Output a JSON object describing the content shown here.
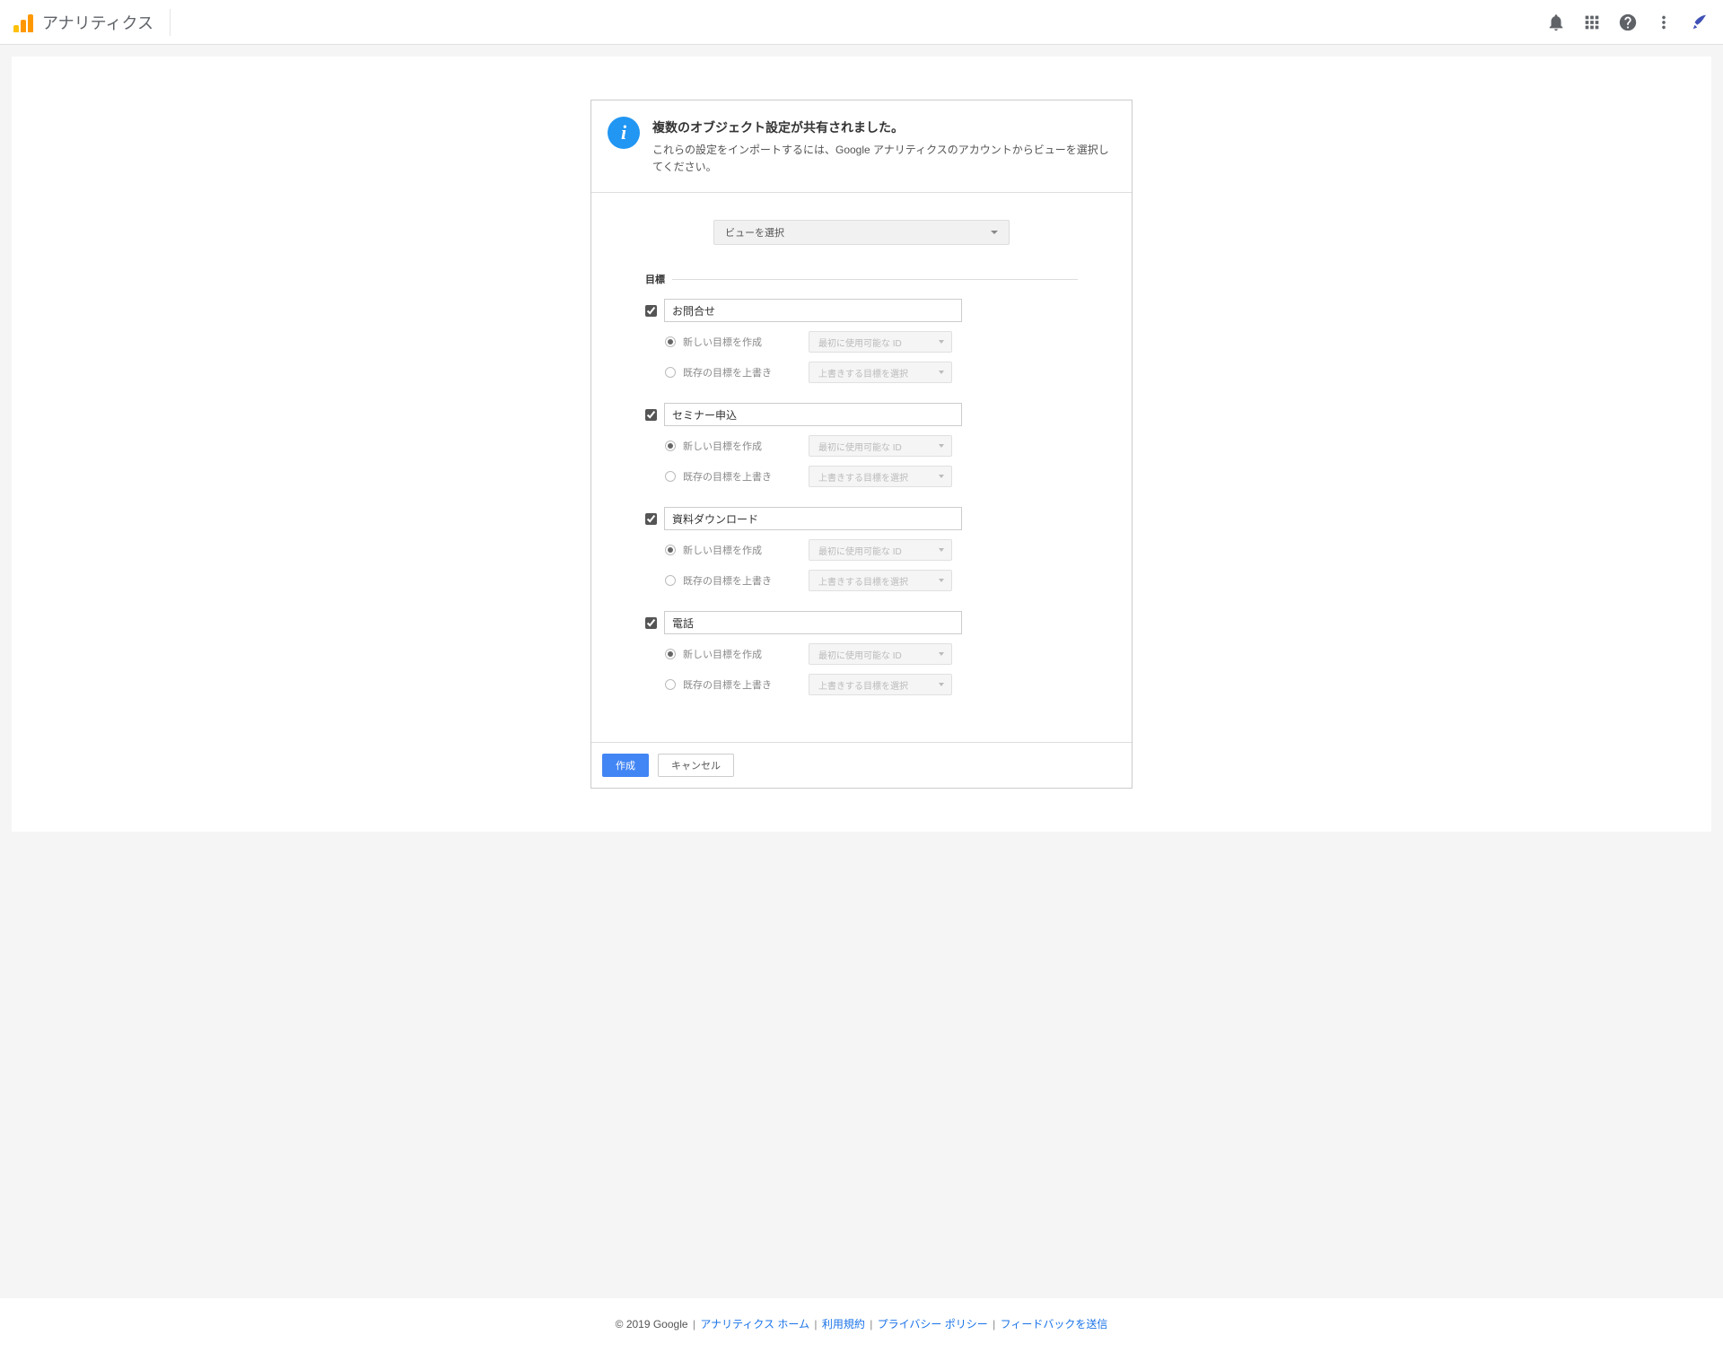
{
  "header": {
    "app_title": "アナリティクス"
  },
  "card": {
    "title": "複数のオブジェクト設定が共有されました。",
    "description": "これらの設定をインポートするには、Google アナリティクスのアカウントからビューを選択してください。"
  },
  "view_selector": {
    "label": "ビューを選択"
  },
  "section": {
    "goals_heading": "目標"
  },
  "goals": [
    {
      "name": "お問合せ",
      "checked": true,
      "create_label": "新しい目標を作成",
      "create_placeholder": "最初に使用可能な ID",
      "overwrite_label": "既存の目標を上書き",
      "overwrite_placeholder": "上書きする目標を選択"
    },
    {
      "name": "セミナー申込",
      "checked": true,
      "create_label": "新しい目標を作成",
      "create_placeholder": "最初に使用可能な ID",
      "overwrite_label": "既存の目標を上書き",
      "overwrite_placeholder": "上書きする目標を選択"
    },
    {
      "name": "資料ダウンロード",
      "checked": true,
      "create_label": "新しい目標を作成",
      "create_placeholder": "最初に使用可能な ID",
      "overwrite_label": "既存の目標を上書き",
      "overwrite_placeholder": "上書きする目標を選択"
    },
    {
      "name": "電話",
      "checked": true,
      "create_label": "新しい目標を作成",
      "create_placeholder": "最初に使用可能な ID",
      "overwrite_label": "既存の目標を上書き",
      "overwrite_placeholder": "上書きする目標を選択"
    }
  ],
  "buttons": {
    "create": "作成",
    "cancel": "キャンセル"
  },
  "footer": {
    "copyright": "© 2019 Google",
    "links": {
      "home": "アナリティクス ホーム",
      "tos": "利用規約",
      "privacy": "プライバシー ポリシー",
      "feedback": "フィードバックを送信"
    }
  }
}
